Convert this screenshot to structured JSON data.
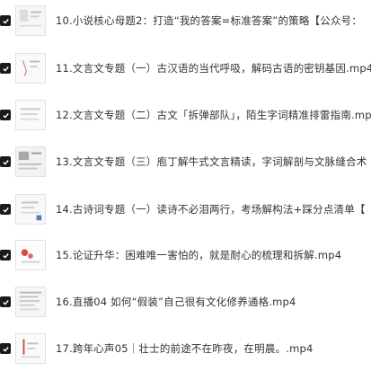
{
  "files": [
    {
      "name": "10.小说核心母题2：打造“我的答案=标准答案”的策略【公众号：",
      "checked": true
    },
    {
      "name": "11.文言文专题（一）古汉语的当代呼吸，解码古语的密钥基因.mp4",
      "checked": true
    },
    {
      "name": "12.文言文专题（二）古文「拆弹部队」，陌生字词精准排雷指南.mp4",
      "checked": true
    },
    {
      "name": "13.文言文专题（三）庖丁解牛式文言精读，字词解剖与文脉缝合术",
      "checked": true
    },
    {
      "name": "14.古诗词专题（一）读诗不必泪两行，考场解构法+踩分点清单【",
      "checked": true
    },
    {
      "name": "15.论证升华：困难唯一害怕的，就是耐心的梳理和拆解.mp4",
      "checked": true
    },
    {
      "name": "16.直播04 如何“假装”自己很有文化修养通格.mp4",
      "checked": true
    },
    {
      "name": "17.跨年心声05｜壮士的前途不在昨夜，在明晨。.mp4",
      "checked": true
    }
  ],
  "icons": {
    "checkbox": "check-icon",
    "thumbnail": "video-thumbnail"
  }
}
